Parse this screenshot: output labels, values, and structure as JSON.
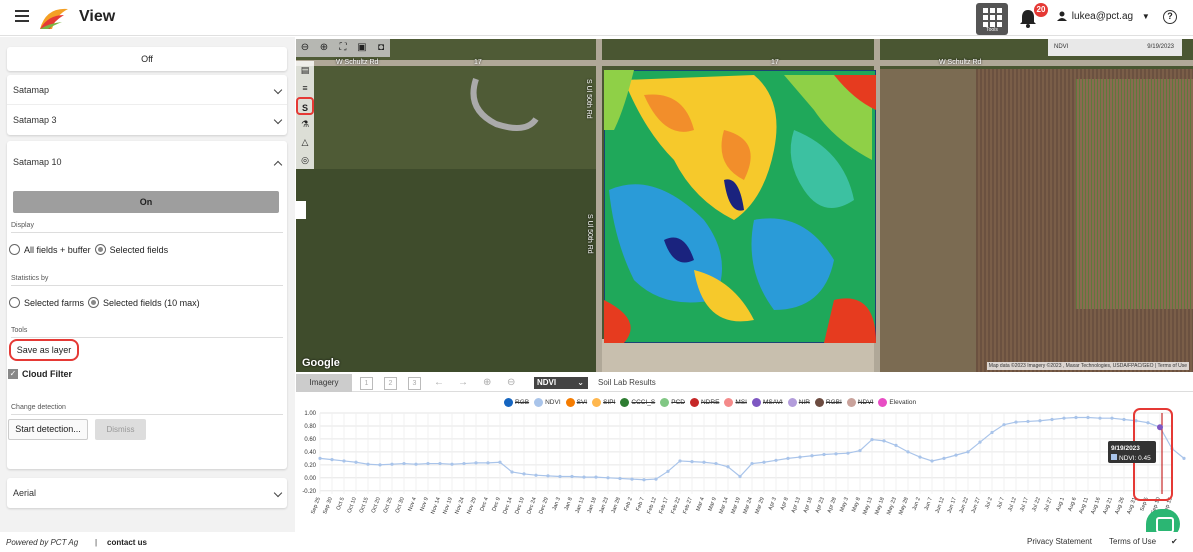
{
  "header": {
    "title": "View",
    "tools_label": "Tools",
    "notifications_count": "20",
    "user": "lukea@pct.ag"
  },
  "sidebar": {
    "off_label": "Off",
    "satamap_label": "Satamap",
    "satamap3_label": "Satamap 3",
    "satamap10_label": "Satamap 10",
    "on_label": "On",
    "display_label": "Display",
    "display_options": [
      "All fields + buffer",
      "Selected fields"
    ],
    "statistics_label": "Statistics by",
    "statistics_options": [
      "Selected farms",
      "Selected fields (10 max)"
    ],
    "tools_label": "Tools",
    "save_layer_label": "Save as layer",
    "cloud_filter_label": "Cloud Filter",
    "change_detection_label": "Change detection",
    "start_detection_label": "Start detection...",
    "dismiss_label": "Dismiss",
    "aerial_label": "Aerial"
  },
  "map": {
    "layer_name": "NDVI",
    "layer_date": "9/19/2023",
    "roads": {
      "west": "W Schultz Rd",
      "east": "W Schultz Rd",
      "ns_1": "S Ul 50th Rd",
      "ns_2": "S Ul 50th Rd",
      "num": "17"
    },
    "google_label": "Google",
    "attribution": "Map data ©2023 Imagery ©2023 , Maxar Technologies, USDA/FPAC/GEO | Terms of Use",
    "icons": [
      "zoom-out-icon",
      "zoom-in-icon",
      "fullscreen-icon",
      "camera-icon",
      "screenshot-icon"
    ]
  },
  "chart_panel": {
    "imagery_tab": "Imagery",
    "index_selected": "NDVI",
    "soil_lab_label": "Soil Lab Results",
    "legend": [
      {
        "name": "RGB",
        "color": "#1565c0",
        "strike": true
      },
      {
        "name": "NDVI",
        "color": "#a9c4ea",
        "strike": false
      },
      {
        "name": "SVI",
        "color": "#f57c00",
        "strike": true
      },
      {
        "name": "SIPI",
        "color": "#ffb74d",
        "strike": true
      },
      {
        "name": "CCCI_S",
        "color": "#2e7d32",
        "strike": true
      },
      {
        "name": "PCD",
        "color": "#81c784",
        "strike": true
      },
      {
        "name": "NDRE",
        "color": "#c62828",
        "strike": true
      },
      {
        "name": "MSI",
        "color": "#f48a8a",
        "strike": true
      },
      {
        "name": "MSAVI",
        "color": "#7e57c2",
        "strike": true
      },
      {
        "name": "NIR",
        "color": "#b39ddb",
        "strike": true
      },
      {
        "name": "RGBI",
        "color": "#6d4c41",
        "strike": true
      },
      {
        "name": "NDVI",
        "color": "#c9a29b",
        "strike": true
      },
      {
        "name": "Elevation",
        "color": "#e84dc4",
        "strike": false
      }
    ],
    "tooltip": {
      "date": "9/19/2023",
      "series": "NDVI",
      "value": "0.45"
    }
  },
  "chart_data": {
    "type": "line",
    "ylim": [
      -0.25,
      1.0
    ],
    "yticks": [
      "1.00",
      "0.80",
      "0.60",
      "0.40",
      "0.20",
      "0.00",
      "-0.20"
    ],
    "x": [
      "Sep 25",
      "Sep 30",
      "Oct 5",
      "Oct 10",
      "Oct 15",
      "Oct 20",
      "Oct 25",
      "Oct 30",
      "Nov 4",
      "Nov 9",
      "Nov 14",
      "Nov 19",
      "Nov 24",
      "Nov 29",
      "Dec 4",
      "Dec 9",
      "Dec 14",
      "Dec 19",
      "Dec 24",
      "Dec 29",
      "Jan 3",
      "Jan 8",
      "Jan 13",
      "Jan 18",
      "Jan 23",
      "Jan 28",
      "Feb 2",
      "Feb 7",
      "Feb 12",
      "Feb 17",
      "Feb 22",
      "Feb 27",
      "Mar 4",
      "Mar 9",
      "Mar 14",
      "Mar 19",
      "Mar 24",
      "Mar 29",
      "Apr 3",
      "Apr 8",
      "Apr 13",
      "Apr 18",
      "Apr 23",
      "Apr 28",
      "May 3",
      "May 8",
      "May 13",
      "May 18",
      "May 23",
      "May 28",
      "Jun 2",
      "Jun 7",
      "Jun 12",
      "Jun 17",
      "Jun 22",
      "Jun 27",
      "Jul 2",
      "Jul 7",
      "Jul 12",
      "Jul 17",
      "Jul 22",
      "Jul 27",
      "Aug 1",
      "Aug 6",
      "Aug 11",
      "Aug 16",
      "Aug 21",
      "Aug 26",
      "Aug 31",
      "Sep 5",
      "Sep 10",
      "Sep 15"
    ],
    "series": [
      {
        "name": "NDVI",
        "color": "#a9c4ea",
        "values": [
          0.3,
          0.28,
          0.26,
          0.24,
          0.21,
          0.2,
          0.21,
          0.22,
          0.21,
          0.22,
          0.22,
          0.21,
          0.22,
          0.23,
          0.23,
          0.24,
          0.09,
          0.06,
          0.04,
          0.03,
          0.02,
          0.02,
          0.01,
          0.01,
          0.0,
          -0.01,
          -0.02,
          -0.03,
          -0.02,
          0.1,
          0.26,
          0.25,
          0.24,
          0.22,
          0.17,
          0.02,
          0.22,
          0.24,
          0.27,
          0.3,
          0.32,
          0.34,
          0.36,
          0.37,
          0.38,
          0.42,
          0.59,
          0.57,
          0.5,
          0.4,
          0.32,
          0.26,
          0.3,
          0.35,
          0.4,
          0.55,
          0.7,
          0.82,
          0.86,
          0.87,
          0.88,
          0.9,
          0.92,
          0.93,
          0.93,
          0.92,
          0.92,
          0.9,
          0.88,
          0.85,
          0.78,
          0.45,
          0.3
        ]
      }
    ]
  }
}
